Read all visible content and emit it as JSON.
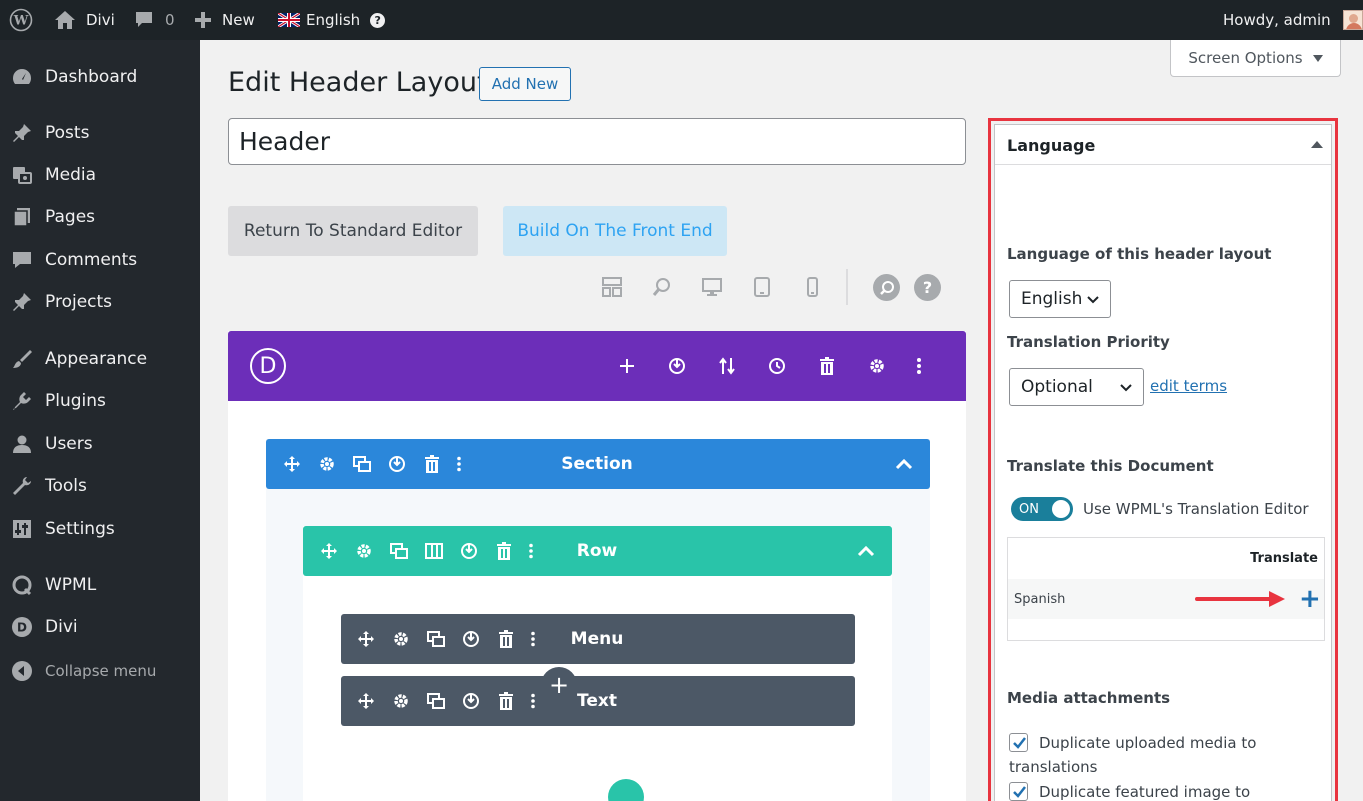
{
  "adminbar": {
    "site_name": "Divi",
    "comments_count": "0",
    "new_label": "New",
    "language_label": "English",
    "howdy": "Howdy, admin"
  },
  "sidebar": {
    "items": [
      {
        "label": "Dashboard",
        "icon": "dashboard-icon"
      },
      {
        "label": "Posts",
        "icon": "pin-icon"
      },
      {
        "label": "Media",
        "icon": "media-icon"
      },
      {
        "label": "Pages",
        "icon": "pages-icon"
      },
      {
        "label": "Comments",
        "icon": "comment-icon"
      },
      {
        "label": "Projects",
        "icon": "pin-icon"
      },
      {
        "label": "Appearance",
        "icon": "brush-icon"
      },
      {
        "label": "Plugins",
        "icon": "plug-icon"
      },
      {
        "label": "Users",
        "icon": "user-icon"
      },
      {
        "label": "Tools",
        "icon": "wrench-icon"
      },
      {
        "label": "Settings",
        "icon": "settings-icon"
      },
      {
        "label": "WPML",
        "icon": "wpml-icon"
      },
      {
        "label": "Divi",
        "icon": "divi-icon"
      }
    ],
    "collapse_label": "Collapse menu"
  },
  "main": {
    "screen_options": "Screen Options",
    "page_title": "Edit Header Layout",
    "add_new": "Add New",
    "title_value": "Header",
    "btn_standard": "Return To Standard Editor",
    "btn_front": "Build On The Front End",
    "help_glyph": "?"
  },
  "builder": {
    "logo": "D",
    "section_title": "Section",
    "row_title": "Row",
    "modules": [
      "Menu",
      "Text"
    ],
    "add_glyph": "+"
  },
  "language_box": {
    "title": "Language",
    "lang_label": "Language of this header layout",
    "lang_value": "English",
    "priority_label": "Translation Priority",
    "priority_value": "Optional",
    "edit_terms": "edit terms",
    "translate_doc_label": "Translate this Document",
    "toggle_state": "ON",
    "toggle_text": "Use WPML's Translation Editor",
    "table_header": "Translate",
    "rows": [
      {
        "language": "Spanish",
        "action": "+"
      }
    ],
    "media_label": "Media attachments",
    "cb_uploaded_1": "Duplicate uploaded media to",
    "cb_uploaded_2": "translations",
    "cb_featured": "Duplicate featured image to translations"
  },
  "colors": {
    "adminbar_bg": "#1d2327",
    "sidebar_bg": "#23282d",
    "divi_purple": "#6c2eb9",
    "section_blue": "#2b87da",
    "row_teal": "#29c4a9",
    "module_gray": "#4c5866",
    "highlight_red": "#e8343f",
    "link_blue": "#2271b1"
  }
}
